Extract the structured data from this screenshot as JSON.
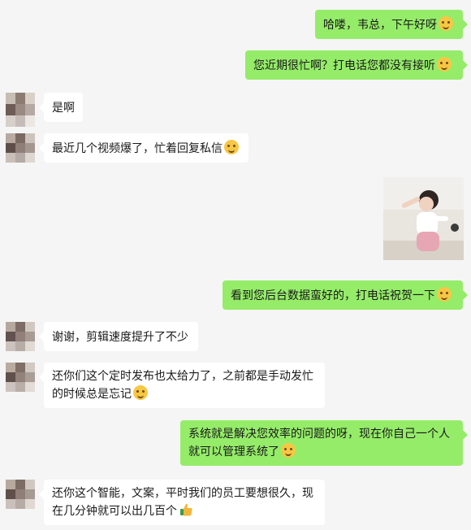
{
  "colors": {
    "background": "#f5f5f5",
    "outgoing_bubble": "#95ec69",
    "incoming_bubble": "#ffffff",
    "emoji": "#f7c744",
    "thumbs_up": "#f2b63d"
  },
  "messages": [
    {
      "side": "out",
      "text": "哈喽，韦总，下午好呀",
      "emoji": "smile-emoji-icon"
    },
    {
      "side": "out",
      "text": "您近期很忙啊？打电话您都没有接听",
      "emoji": "laughing-emoji-icon"
    },
    {
      "side": "in",
      "text": "是啊"
    },
    {
      "side": "in",
      "text": "最近几个视频爆了，忙着回复私信",
      "emoji": "wink-emoji-icon"
    },
    {
      "side": "in",
      "image": "photo-of-child"
    },
    {
      "side": "out",
      "text": "看到您后台数据蛮好的，打电话祝贺一下",
      "emoji": "smile-emoji-icon"
    },
    {
      "side": "in",
      "text": "谢谢，剪辑速度提升了不少"
    },
    {
      "side": "in",
      "text": "还你们这个定时发布也太给力了，之前都是手动发忙的时候总是忘记",
      "emoji": "wink-emoji-icon"
    },
    {
      "side": "out",
      "text": "系统就是解决您效率的问题的呀，现在你自己一个人就可以管理系统了",
      "emoji": "grin-emoji-icon"
    },
    {
      "side": "in",
      "text": "还你这个智能，文案，平时我们的员工要想很久，现在几分钟就可以出几百个",
      "emoji": "thumbs-up-icon"
    }
  ]
}
